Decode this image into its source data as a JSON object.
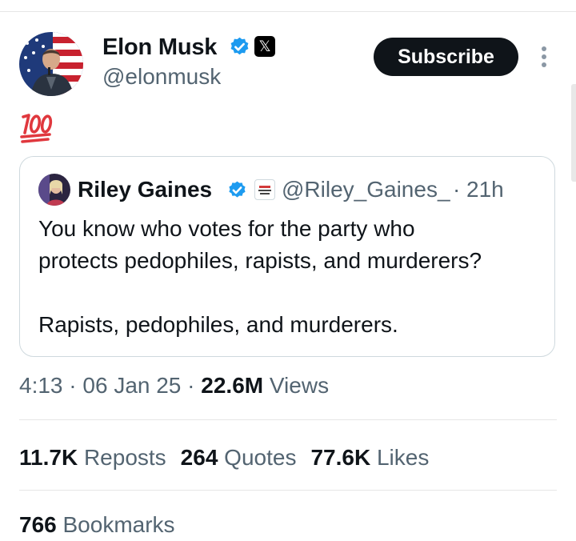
{
  "tweet": {
    "author": {
      "name": "Elon Musk",
      "handle": "@elonmusk",
      "affiliate_glyph": "𝕏"
    },
    "subscribe_label": "Subscribe",
    "body_emoji": "100-emoji",
    "quoted": {
      "name": "Riley Gaines",
      "handle": "@Riley_Gaines_",
      "separator": "·",
      "time": "21h",
      "text": "You know who votes for the party who\nprotects pedophiles, rapists, and murderers?\n\nRapists, pedophiles, and murderers."
    },
    "meta": {
      "time": "4:13",
      "sep1": " · ",
      "date": "06 Jan 25",
      "sep2": " · ",
      "views_count": "22.6M",
      "views_label": "Views"
    },
    "stats": {
      "reposts_count": "11.7K",
      "reposts_label": "Reposts",
      "quotes_count": "264",
      "quotes_label": "Quotes",
      "likes_count": "77.6K",
      "likes_label": "Likes",
      "bookmarks_count": "766",
      "bookmarks_label": "Bookmarks"
    }
  },
  "colors": {
    "verified_blue": "#1d9bf0",
    "text_primary": "#0f1419",
    "text_secondary": "#536471",
    "border": "#cfd9de",
    "emoji_red": "#e0383e"
  }
}
